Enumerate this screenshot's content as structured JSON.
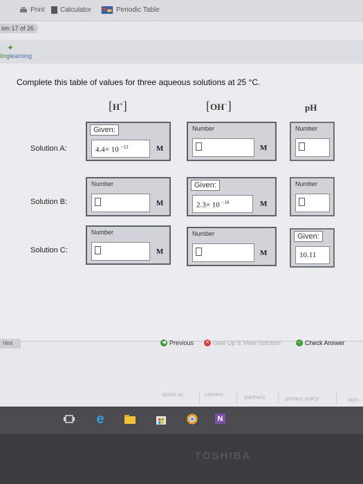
{
  "toolbar": {
    "print_label": "Print",
    "calculator_label": "Calculator",
    "periodic_table_label": "Periodic Table"
  },
  "question_number": "ion 17 of 26",
  "brand": {
    "left": "ling",
    "right": "learning"
  },
  "question": "Complete this table of values for three aqueous solutions at 25 °C.",
  "columns": {
    "h": "H",
    "h_sup": "+",
    "oh": "OH",
    "oh_sup": "−",
    "ph": "pH"
  },
  "rows": {
    "a": "Solution A:",
    "b": "Solution B:",
    "c": "Solution C:"
  },
  "cells": {
    "a_h": {
      "caption": "Given:",
      "value": "4.4× 10",
      "exp": "−13",
      "unit": "M"
    },
    "a_oh": {
      "caption": "Number",
      "unit": "M"
    },
    "a_ph": {
      "caption": "Number"
    },
    "b_h": {
      "caption": "Number",
      "unit": "M"
    },
    "b_oh": {
      "caption": "Given:",
      "value": "2.3× 10",
      "exp": "−10",
      "unit": "M"
    },
    "b_ph": {
      "caption": "Number"
    },
    "c_h": {
      "caption": "Number",
      "unit": "M"
    },
    "c_oh": {
      "caption": "Number",
      "unit": "M"
    },
    "c_ph": {
      "caption": "Given:",
      "value": "10.11"
    }
  },
  "hint_label": "Hint",
  "actions": {
    "previous": "Previous",
    "give_up": "Give Up & View Solution",
    "check": "Check Answer"
  },
  "footer": [
    "about us",
    "careers",
    "partners",
    "privacy policy",
    "term"
  ],
  "bezel_brand": "TOSHIBA",
  "colors": {
    "green": "#3d9a3a",
    "red": "#d04040",
    "bezel": "#3c3b3e"
  }
}
